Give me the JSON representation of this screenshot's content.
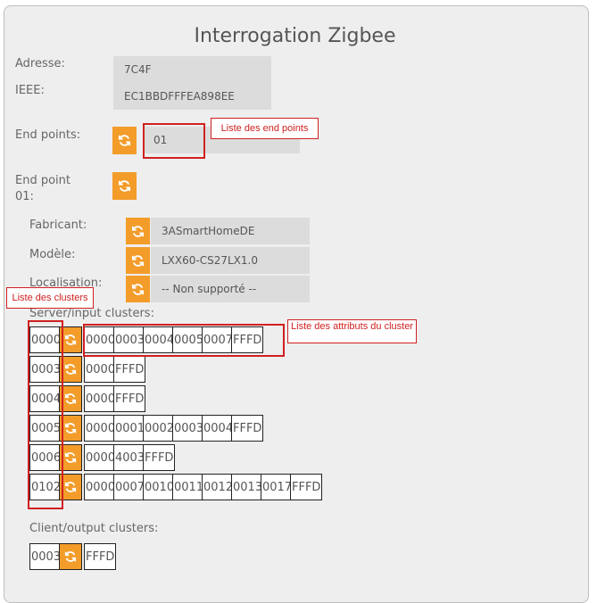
{
  "title": "Interrogation Zigbee",
  "labels": {
    "adresse": "Adresse:",
    "ieee": "IEEE:",
    "end_points": "End points:",
    "end_point_line1": "End point",
    "end_point_line2": "01:",
    "fabricant": "Fabricant:",
    "modele": "Modèle:",
    "localisation": "Localisation:",
    "server_clusters": "Server/input clusters:",
    "client_clusters": "Client/output clusters:"
  },
  "values": {
    "adresse": "7C4F",
    "ieee": "EC1BBDFFFEA898EE",
    "end_point": "01",
    "fabricant": "3ASmartHomeDE",
    "modele": "LXX60-CS27LX1.0",
    "localisation": "-- Non supporté --"
  },
  "annotations": {
    "end_points": "Liste des end points",
    "clusters": "Liste des clusters",
    "attributes": "Liste des attributs du cluster"
  },
  "server_clusters": [
    {
      "id": "0000",
      "attrs": [
        "0000",
        "0003",
        "0004",
        "0005",
        "0007",
        "FFFD"
      ]
    },
    {
      "id": "0003",
      "attrs": [
        "0000",
        "FFFD"
      ]
    },
    {
      "id": "0004",
      "attrs": [
        "0000",
        "FFFD"
      ]
    },
    {
      "id": "0005",
      "attrs": [
        "0000",
        "0001",
        "0002",
        "0003",
        "0004",
        "FFFD"
      ]
    },
    {
      "id": "0006",
      "attrs": [
        "0000",
        "4003",
        "FFFD"
      ]
    },
    {
      "id": "0102",
      "attrs": [
        "0000",
        "0007",
        "0010",
        "0011",
        "0012",
        "0013",
        "0017",
        "FFFD"
      ]
    }
  ],
  "client_clusters": [
    {
      "id": "0003",
      "attrs": [
        "FFFD"
      ]
    }
  ],
  "colors": {
    "accent": "#f39c2a",
    "annotation": "#d02020"
  }
}
